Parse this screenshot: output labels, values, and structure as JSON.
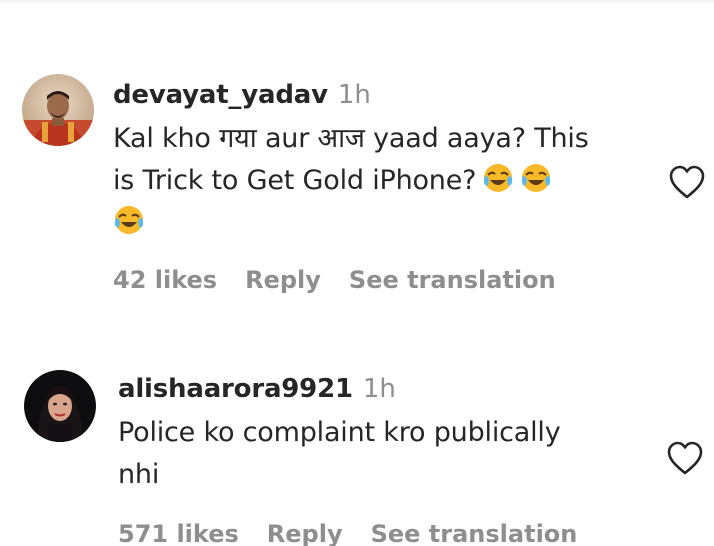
{
  "comments": [
    {
      "username": "devayat_yadav",
      "time": "1h",
      "text_line1": "Kal kho गया aur आज yaad aaya? This",
      "text_line2": "is Trick to Get Gold iPhone?",
      "emoji_name": "face-with-tears-of-joy",
      "emoji_count": 3,
      "likes": "42 likes",
      "reply": "Reply",
      "see_translation": "See translation"
    },
    {
      "username": "alishaarora9921",
      "time": "1h",
      "text_line1": "Police ko complaint kro publically",
      "text_line2": "nhi",
      "likes": "571 likes",
      "reply": "Reply",
      "see_translation": "See translation"
    }
  ],
  "icons": {
    "like": "heart-outline-icon"
  },
  "colors": {
    "primary_text": "#262626",
    "secondary_text": "#8e8e8e",
    "emoji_yellow": "#f7b928"
  }
}
